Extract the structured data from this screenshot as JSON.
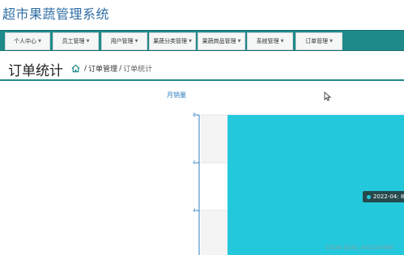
{
  "app": {
    "title": "超市果蔬管理系统"
  },
  "nav": {
    "items": [
      {
        "label": "个人中心"
      },
      {
        "label": "员工管理"
      },
      {
        "label": "用户管理"
      },
      {
        "label": "果蔬分类管理"
      },
      {
        "label": "果蔬商品管理"
      },
      {
        "label": "系统管理"
      },
      {
        "label": "订单管理"
      }
    ]
  },
  "page": {
    "title": "订单统计",
    "breadcrumb": {
      "parent": "订单管理",
      "separator": "/",
      "current": "订单统计"
    }
  },
  "colors": {
    "accent": "#1f8a8a",
    "bar": "#24c8dc",
    "title": "#2e6da4"
  },
  "tooltip": {
    "text": "2022-04: 8"
  },
  "watermark": {
    "text": "CSDN @QQ_402205498"
  },
  "chart_data": {
    "type": "bar",
    "title": "月销量",
    "categories": [
      "2022-04"
    ],
    "values": [
      8
    ],
    "yticks": [
      "8",
      "6",
      "4"
    ],
    "ylim": [
      0,
      8
    ],
    "grid": true
  }
}
